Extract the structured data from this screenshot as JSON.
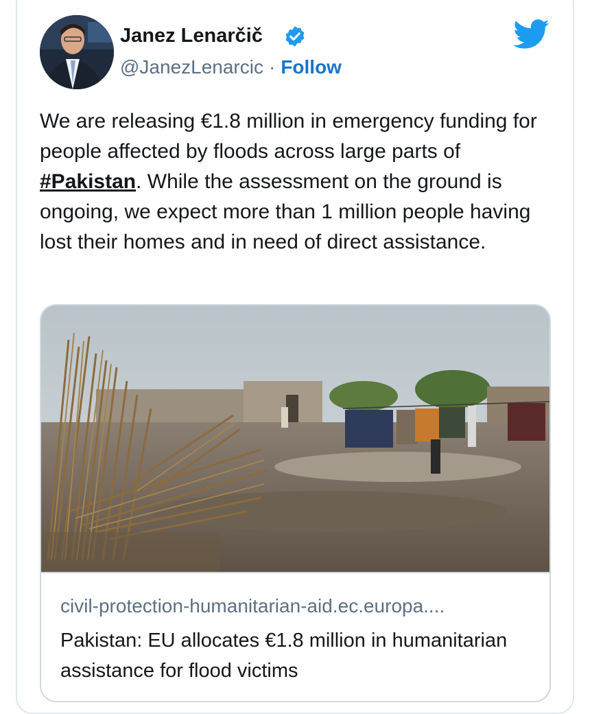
{
  "tweet": {
    "author_name": "Janez Lenarčič",
    "handle": "@JanezLenarcic",
    "separator": "·",
    "follow_label": "Follow",
    "text_before": "We are releasing €1.8 million in emergency funding for people affected by floods across large parts of ",
    "hashtag": "#Pakistan",
    "text_after": ". While the assessment on the ground is ongoing, we expect more than 1 million people having lost their homes and in need of direct assistance."
  },
  "link_card": {
    "domain": "civil-protection-humanitarian-aid.ec.europa....",
    "title": "Pakistan: EU allocates €1.8 million in humanitarian assistance for flood victims"
  },
  "icons": {
    "verified": "verified-badge-icon",
    "logo": "twitter-bird-icon"
  },
  "colors": {
    "follow": "#1b74c7",
    "twitter_blue": "#1d9bf0",
    "verified": "#1d9bf0",
    "secondary_text": "#5b7083"
  }
}
